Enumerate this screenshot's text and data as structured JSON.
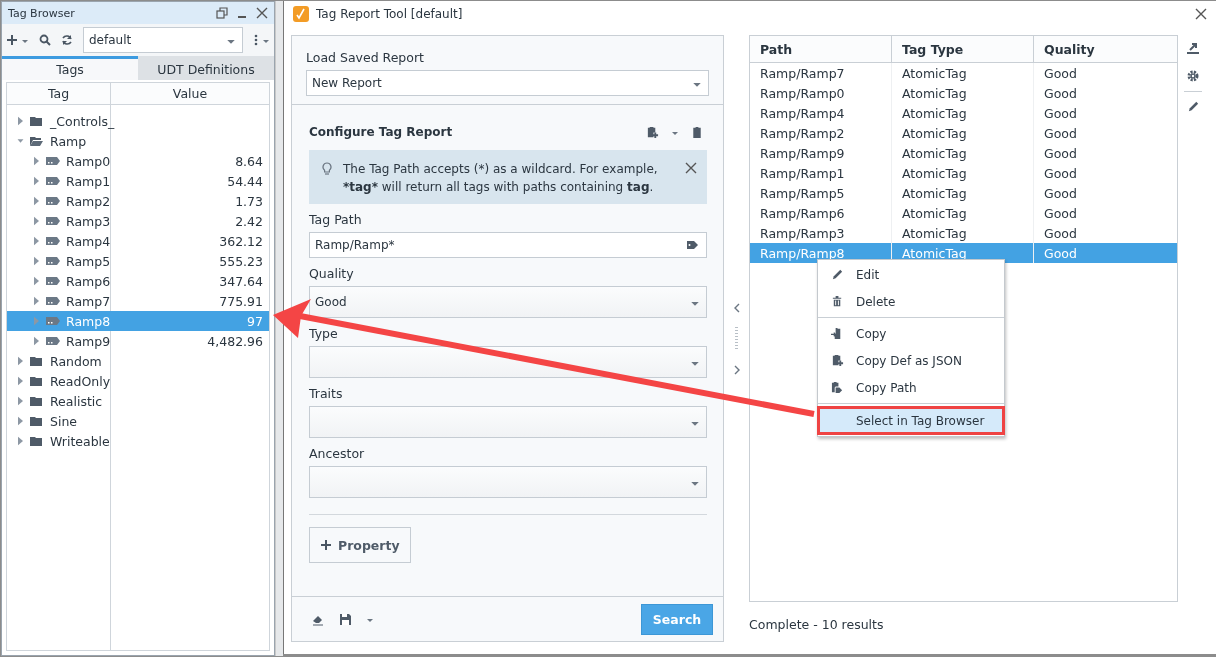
{
  "tag_browser": {
    "title": "Tag Browser",
    "provider": "default",
    "tabs": [
      {
        "label": "Tags",
        "selected": true
      },
      {
        "label": "UDT Definitions",
        "selected": false
      }
    ],
    "columns": [
      "Tag",
      "Value"
    ],
    "tree": [
      {
        "label": "_Controls_",
        "kind": "folder",
        "expanded": false,
        "selected": false
      },
      {
        "label": "Ramp",
        "kind": "folder",
        "expanded": true,
        "selected": false,
        "children": [
          {
            "label": "Ramp0",
            "kind": "tag",
            "value": "8.64",
            "selected": false
          },
          {
            "label": "Ramp1",
            "kind": "tag",
            "value": "54.44",
            "selected": false
          },
          {
            "label": "Ramp2",
            "kind": "tag",
            "value": "1.73",
            "selected": false
          },
          {
            "label": "Ramp3",
            "kind": "tag",
            "value": "2.42",
            "selected": false
          },
          {
            "label": "Ramp4",
            "kind": "tag",
            "value": "362.12",
            "selected": false
          },
          {
            "label": "Ramp5",
            "kind": "tag",
            "value": "555.23",
            "selected": false
          },
          {
            "label": "Ramp6",
            "kind": "tag",
            "value": "347.64",
            "selected": false
          },
          {
            "label": "Ramp7",
            "kind": "tag",
            "value": "775.91",
            "selected": false
          },
          {
            "label": "Ramp8",
            "kind": "tag",
            "value": "97",
            "selected": true
          },
          {
            "label": "Ramp9",
            "kind": "tag",
            "value": "4,482.96",
            "selected": false
          }
        ]
      },
      {
        "label": "Random",
        "kind": "folder",
        "expanded": false,
        "selected": false
      },
      {
        "label": "ReadOnly",
        "kind": "folder",
        "expanded": false,
        "selected": false
      },
      {
        "label": "Realistic",
        "kind": "folder",
        "expanded": false,
        "selected": false
      },
      {
        "label": "Sine",
        "kind": "folder",
        "expanded": false,
        "selected": false
      },
      {
        "label": "Writeable",
        "kind": "folder",
        "expanded": false,
        "selected": false
      }
    ]
  },
  "report_tool": {
    "title": "Tag Report Tool [default]",
    "load_saved_report": {
      "label": "Load Saved Report",
      "value": "New Report"
    },
    "configure": {
      "title": "Configure Tag Report",
      "hint": [
        {
          "text": "The Tag Path accepts (*) as a wildcard. For example, ",
          "bold": false
        },
        {
          "text": "*tag*",
          "bold": true
        },
        {
          "text": " will return all tags with paths containing ",
          "bold": false
        },
        {
          "text": "tag",
          "bold": true
        },
        {
          "text": ".",
          "bold": false
        }
      ],
      "fields": [
        {
          "label": "Tag Path",
          "kind": "text",
          "value": "Ramp/Ramp*"
        },
        {
          "label": "Quality",
          "kind": "dropdown",
          "value": "Good"
        },
        {
          "label": "Type",
          "kind": "dropdown"
        },
        {
          "label": "Traits",
          "kind": "dropdown"
        },
        {
          "label": "Ancestor",
          "kind": "dropdown"
        }
      ],
      "add_button": "Property",
      "search_button": "Search"
    },
    "results": {
      "columns": [
        "Path",
        "Tag Type",
        "Quality"
      ],
      "rows": [
        {
          "path": "Ramp/Ramp7",
          "type": "AtomicTag",
          "quality": "Good",
          "selected": false
        },
        {
          "path": "Ramp/Ramp0",
          "type": "AtomicTag",
          "quality": "Good",
          "selected": false
        },
        {
          "path": "Ramp/Ramp4",
          "type": "AtomicTag",
          "quality": "Good",
          "selected": false
        },
        {
          "path": "Ramp/Ramp2",
          "type": "AtomicTag",
          "quality": "Good",
          "selected": false
        },
        {
          "path": "Ramp/Ramp9",
          "type": "AtomicTag",
          "quality": "Good",
          "selected": false
        },
        {
          "path": "Ramp/Ramp1",
          "type": "AtomicTag",
          "quality": "Good",
          "selected": false
        },
        {
          "path": "Ramp/Ramp5",
          "type": "AtomicTag",
          "quality": "Good",
          "selected": false
        },
        {
          "path": "Ramp/Ramp6",
          "type": "AtomicTag",
          "quality": "Good",
          "selected": false
        },
        {
          "path": "Ramp/Ramp3",
          "type": "AtomicTag",
          "quality": "Good",
          "selected": false
        },
        {
          "path": "Ramp/Ramp8",
          "type": "AtomicTag",
          "quality": "Good",
          "selected": true
        }
      ],
      "status": "Complete - 10 results"
    },
    "context_menu": {
      "groups": [
        [
          {
            "label": "Edit",
            "highlighted": false
          },
          {
            "label": "Delete",
            "highlighted": false
          }
        ],
        [
          {
            "label": "Copy",
            "highlighted": false
          },
          {
            "label": "Copy Def as JSON",
            "highlighted": false
          },
          {
            "label": "Copy Path",
            "highlighted": false
          }
        ],
        [
          {
            "label": "Select in Tag Browser",
            "highlighted": true
          }
        ]
      ]
    }
  },
  "annotations": [
    {
      "kind": "arrow"
    }
  ]
}
